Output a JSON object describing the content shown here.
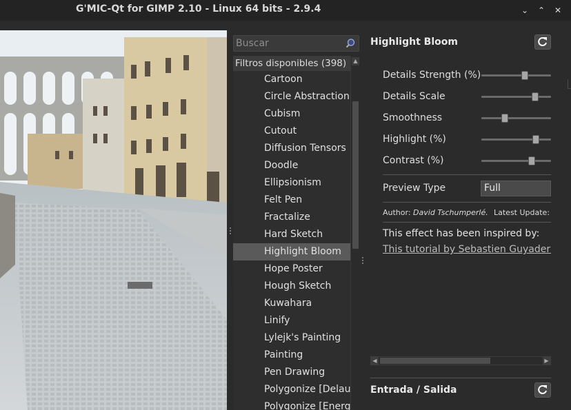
{
  "window": {
    "title": "G'MIC-Qt for GIMP 2.10 - Linux 64 bits - 2.9.4",
    "controls": [
      "⌄",
      "⌃",
      "✕"
    ]
  },
  "search": {
    "placeholder": "Buscar",
    "icon": "magnifier-icon"
  },
  "filters": {
    "header": "Filtros disponibles (398)",
    "items": [
      "Cartoon",
      "Circle Abstraction",
      "Cubism",
      "Cutout",
      "Diffusion Tensors",
      "Doodle",
      "Ellipsionism",
      "Felt Pen",
      "Fractalize",
      "Hard Sketch",
      "Highlight Bloom",
      "Hope Poster",
      "Hough Sketch",
      "Kuwahara",
      "Linify",
      "Lylejk's Painting",
      "Painting",
      "Pen Drawing",
      "Polygonize [Delaunay]",
      "Polygonize [Energy]"
    ],
    "selected": "Highlight Bloom"
  },
  "filter_panel": {
    "name": "Highlight Bloom",
    "params": [
      {
        "label": "Details Strength (%)",
        "level": 0.64
      },
      {
        "label": "Details Scale",
        "level": 0.8
      },
      {
        "label": "Smoothness",
        "level": 0.32
      },
      {
        "label": "Highlight (%)",
        "level": 0.81
      },
      {
        "label": "Contrast (%)",
        "level": 0.75
      }
    ],
    "preview_type_label": "Preview Type",
    "preview_type_value": "Full",
    "author_prefix": "Author:",
    "author_name": "David Tschumperlé.",
    "latest_update": "Latest Update:",
    "description": "This effect has been inspired by:",
    "link": "This tutorial by Sebastien Guyader and Patrick David"
  },
  "io_section": {
    "title": "Entrada / Salida"
  },
  "colors": {
    "background": "#2b2b2b",
    "selected": "#5a5a5a",
    "text": "#e6e6e6"
  }
}
